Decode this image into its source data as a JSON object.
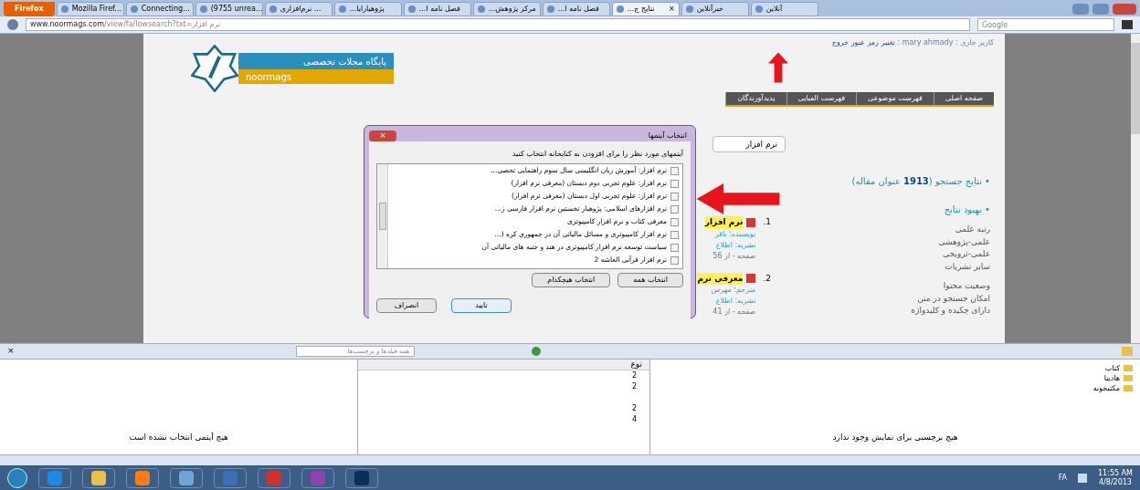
{
  "browser": {
    "menu_button": "Firefox",
    "tabs": [
      {
        "label": "آنلاین",
        "selected": false
      },
      {
        "label": "خبرآنلاین",
        "selected": false
      },
      {
        "label": "...نتایج ج",
        "selected": true
      },
      {
        "label": "...فصل نامه ا",
        "selected": false
      },
      {
        "label": "...مرکز پژوهش",
        "selected": false
      },
      {
        "label": "...فصل نامه ا",
        "selected": false
      },
      {
        "label": "...پژوهیارایا",
        "selected": false
      },
      {
        "label": "نرم‌افزاری ...",
        "selected": false
      },
      {
        "label": "(9755 unrea...",
        "selected": false
      },
      {
        "label": "Connecting...",
        "selected": false
      },
      {
        "label": "Mozilla Firef...",
        "selected": false
      }
    ],
    "close_tab": "×",
    "url_domain": "www.noormags.com",
    "url_path": "/view/fa/lowsearch?txt=نرم افزار",
    "search_placeholder": "Google"
  },
  "site": {
    "user_line": "کاربر جاری : mary ahmady :",
    "change_password": "تغییر رمز عبور",
    "logout": "خروج",
    "logo_title": "پایگاه مجلات تخصصی",
    "logo_name": "noormags",
    "nav": [
      "صفحه اصلی",
      "فهرست موضوعی",
      "فهرست الفبایی",
      "پدیدآورندگان"
    ],
    "search_value": "نرم افزار",
    "results_prefix": "• نتایج جستجو (",
    "results_count": "1913",
    "results_suffix": "عنوان مقاله)",
    "refine_title": "• بهبود نتایج",
    "refine_groups": [
      {
        "title": "رتبه علمی",
        "items": [
          "علمی-پژوهشی",
          "علمی-ترویجی",
          "سایر نشریات"
        ]
      },
      {
        "title": "وضعیت محتوا",
        "items": [
          "امکان جستجو در متن",
          "دارای چکیده و کلیدواژه"
        ]
      }
    ],
    "results": [
      {
        "number": "1.",
        "title": "نرم افزار",
        "author": "نویسنده: باقر",
        "journal": "نشریه: اطلاع",
        "pages": "صفحه - از 56"
      },
      {
        "number": "2.",
        "title": "معرفی نرم",
        "author": "مترجم: مهرس",
        "journal": "نشریه: اطلاع",
        "pages": "صفحه - از 41"
      }
    ]
  },
  "dialog": {
    "title": "انتخاب آیتمها",
    "close": "×",
    "instruction": "آیتمهای مورد نظر را برای افزودن به کتابخانه انتخاب کنید",
    "items": [
      {
        "label": "نرم افزار: آموزش زبان انگلیسی سال سوم راهنمایی تحصی...",
        "checked": false
      },
      {
        "label": "نرم افزار: علوم تجربی دوم دبستان (معرفی نرم افزار)",
        "checked": false
      },
      {
        "label": "نرم افزار: علوم تجربی اول دبستان (معرفی نرم افزار)",
        "checked": false
      },
      {
        "label": "نرم افزارهای اسلامی: پژوهیار نخستین نرم افزار فارسی ز...",
        "checked": false
      },
      {
        "label": "معرفی کتاب و نرم افزار کامپیوتری",
        "checked": false
      },
      {
        "label": "نرم افزار کامپیوتری و مسائل مالیاتی آن در جمهوری کره (...",
        "checked": false
      },
      {
        "label": "سیاست توسعه نرم افزار کامپیوتری در هند و جنبه های مالیاتی آن",
        "checked": false
      },
      {
        "label": "نرم افزار قرآنی العاشه 2",
        "checked": false
      }
    ],
    "select_all": "انتخاب همه",
    "select_none": "انتخاب هیچکدام",
    "ok": "تایید",
    "cancel": "انصراف"
  },
  "zotero": {
    "close": "×",
    "search_placeholder": "همه فیلدها و برچسب‌ها",
    "column": "نوع",
    "rows": [
      "2",
      "2",
      "",
      "2",
      "4"
    ],
    "collections": [
      "کتاب",
      "هادیتا",
      "مکتبخونه"
    ],
    "item_message": "هیچ آیتمی انتخاب نشده است",
    "tags_message": "هیچ برچسبی برای نمایش وجود ندارد"
  },
  "taskbar": {
    "language": "FA",
    "time": "11:55 AM",
    "date": "4/8/2013"
  }
}
